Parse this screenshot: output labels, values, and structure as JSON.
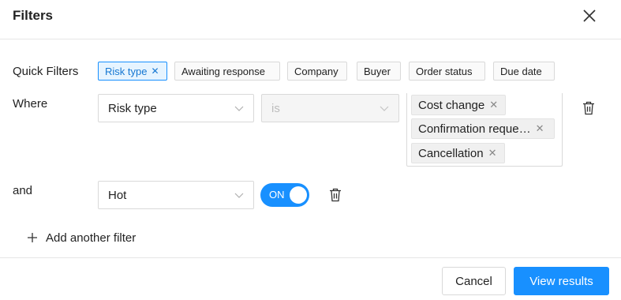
{
  "dialog": {
    "title": "Filters"
  },
  "quick_filters": {
    "label": "Quick Filters",
    "chips": [
      {
        "label": "Risk type",
        "active": true
      },
      {
        "label": "Awaiting response",
        "active": false
      },
      {
        "label": "Company",
        "active": false
      },
      {
        "label": "Buyer",
        "active": false
      },
      {
        "label": "Order status",
        "active": false
      },
      {
        "label": "Due date",
        "active": false
      }
    ]
  },
  "filters": [
    {
      "conjunction": "Where",
      "field": "Risk type",
      "operator_placeholder": "is",
      "values": [
        "Cost change",
        "Confirmation reque…",
        "Cancellation"
      ]
    },
    {
      "conjunction": "and",
      "field": "Hot",
      "toggle_label": "ON",
      "toggle_on": true
    }
  ],
  "add_filter_label": "Add another filter",
  "footer": {
    "cancel_label": "Cancel",
    "submit_label": "View results"
  },
  "colors": {
    "accent": "#1890ff",
    "active_chip_bg": "#e6f4ff",
    "border": "#d9d9d9"
  },
  "icons": {
    "close": "close-icon",
    "chevron": "chevron-down-icon",
    "trash": "trash-icon",
    "plus": "plus-icon"
  }
}
